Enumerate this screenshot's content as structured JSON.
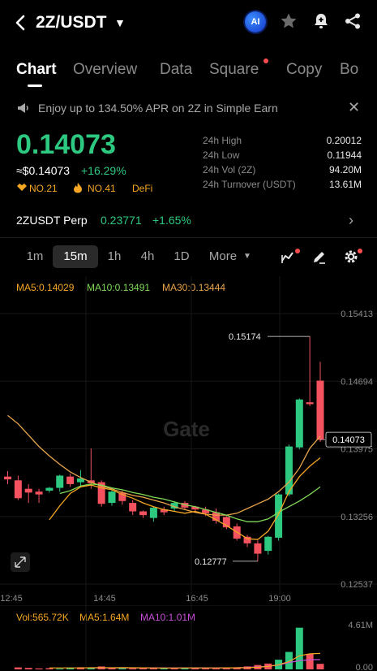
{
  "header": {
    "pair": "2Z/USDT",
    "ai_badge": "AI",
    "icons": [
      "back-icon",
      "caret-down-icon",
      "ai-icon",
      "star-icon",
      "bell-plus-icon",
      "share-icon"
    ]
  },
  "tabs": [
    {
      "label": "Chart",
      "active": true
    },
    {
      "label": "Overview",
      "active": false
    },
    {
      "label": "Data",
      "active": false
    },
    {
      "label": "Square",
      "active": false,
      "dot": true
    },
    {
      "label": "Copy",
      "active": false
    },
    {
      "label": "Bo",
      "active": false
    }
  ],
  "banner": {
    "text": "Enjoy up to 134.50% APR on 2Z in Simple Earn",
    "close": "✕"
  },
  "ticker": {
    "price": "0.14073",
    "fiat": "≈$0.14073",
    "change": "+16.29%",
    "tags": [
      "NO.21",
      "NO.41",
      "DeFi"
    ]
  },
  "stats": [
    {
      "label": "24h High",
      "value": "0.20012"
    },
    {
      "label": "24h Low",
      "value": "0.11944"
    },
    {
      "label": "24h Vol (2Z)",
      "value": "94.20M"
    },
    {
      "label": "24h Turnover (USDT)",
      "value": "13.61M"
    }
  ],
  "perp": {
    "name": "2ZUSDT Perp",
    "price": "0.23771",
    "change": "+1.65%"
  },
  "intervals": [
    {
      "label": "1m",
      "active": false
    },
    {
      "label": "15m",
      "active": true
    },
    {
      "label": "1h",
      "active": false
    },
    {
      "label": "4h",
      "active": false
    },
    {
      "label": "1D",
      "active": false
    },
    {
      "label": "More",
      "active": false
    }
  ],
  "ma": {
    "ma5": "MA5:0.14029",
    "ma10": "MA10:0.13491",
    "ma30": "MA30:0.13444"
  },
  "colors": {
    "up": "#2ec981",
    "down": "#f5525f",
    "ma5": "#f5a623",
    "ma10": "#7ed957",
    "ma30": "#e8a44a",
    "ma10_vol": "#c84ed8"
  },
  "chart_data": {
    "type": "candlestick",
    "y_ticks": [
      "0.15413",
      "0.14694",
      "0.13975",
      "0.13256",
      "0.12537"
    ],
    "ylim": [
      0.12537,
      0.15413
    ],
    "x_ticks": [
      "12:45",
      "14:45",
      "16:45",
      "19:00"
    ],
    "watermark": "Gate",
    "current_price_label": "0.14073",
    "high_label": "0.15174",
    "low_label": "0.12777",
    "candles": [
      {
        "o": 0.1368,
        "h": 0.1374,
        "c": 0.1365,
        "l": 0.136,
        "up": false
      },
      {
        "o": 0.1364,
        "h": 0.1369,
        "c": 0.1345,
        "l": 0.1343,
        "up": false
      },
      {
        "o": 0.1355,
        "h": 0.136,
        "c": 0.1351,
        "l": 0.134,
        "up": false
      },
      {
        "o": 0.1352,
        "h": 0.1355,
        "c": 0.1349,
        "l": 0.134,
        "up": false
      },
      {
        "o": 0.1353,
        "h": 0.1357,
        "c": 0.1356,
        "l": 0.1351,
        "up": true
      },
      {
        "o": 0.1356,
        "h": 0.137,
        "c": 0.1369,
        "l": 0.1352,
        "up": true
      },
      {
        "o": 0.1368,
        "h": 0.1371,
        "c": 0.136,
        "l": 0.1357,
        "up": false
      },
      {
        "o": 0.1362,
        "h": 0.1375,
        "c": 0.1366,
        "l": 0.1358,
        "up": true
      },
      {
        "o": 0.1364,
        "h": 0.1398,
        "c": 0.1361,
        "l": 0.1355,
        "up": false
      },
      {
        "o": 0.1362,
        "h": 0.1364,
        "c": 0.1339,
        "l": 0.1336,
        "up": false
      },
      {
        "o": 0.134,
        "h": 0.1354,
        "c": 0.1352,
        "l": 0.1337,
        "up": true
      },
      {
        "o": 0.1351,
        "h": 0.1353,
        "c": 0.1342,
        "l": 0.1338,
        "up": false
      },
      {
        "o": 0.134,
        "h": 0.1343,
        "c": 0.1331,
        "l": 0.1327,
        "up": false
      },
      {
        "o": 0.1331,
        "h": 0.1332,
        "c": 0.1327,
        "l": 0.1324,
        "up": false
      },
      {
        "o": 0.1324,
        "h": 0.1336,
        "c": 0.1335,
        "l": 0.132,
        "up": true
      },
      {
        "o": 0.1333,
        "h": 0.1336,
        "c": 0.133,
        "l": 0.1327,
        "up": false
      },
      {
        "o": 0.1334,
        "h": 0.1342,
        "c": 0.134,
        "l": 0.1331,
        "up": true
      },
      {
        "o": 0.134,
        "h": 0.1342,
        "c": 0.1335,
        "l": 0.1333,
        "up": false
      },
      {
        "o": 0.1336,
        "h": 0.1337,
        "c": 0.1333,
        "l": 0.1331,
        "up": false
      },
      {
        "o": 0.1333,
        "h": 0.1336,
        "c": 0.1329,
        "l": 0.1326,
        "up": false
      },
      {
        "o": 0.133,
        "h": 0.1334,
        "c": 0.1321,
        "l": 0.1318,
        "up": false
      },
      {
        "o": 0.1325,
        "h": 0.1326,
        "c": 0.1314,
        "l": 0.1312,
        "up": false
      },
      {
        "o": 0.1315,
        "h": 0.1318,
        "c": 0.1302,
        "l": 0.13,
        "up": false
      },
      {
        "o": 0.1304,
        "h": 0.1306,
        "c": 0.1297,
        "l": 0.1293,
        "up": false
      },
      {
        "o": 0.1297,
        "h": 0.13,
        "c": 0.1286,
        "l": 0.1278,
        "up": false
      },
      {
        "o": 0.1289,
        "h": 0.1305,
        "c": 0.1304,
        "l": 0.1285,
        "up": true
      },
      {
        "o": 0.1303,
        "h": 0.135,
        "c": 0.1349,
        "l": 0.13,
        "up": true
      },
      {
        "o": 0.1349,
        "h": 0.1402,
        "c": 0.14,
        "l": 0.1347,
        "up": true
      },
      {
        "o": 0.1399,
        "h": 0.1451,
        "c": 0.145,
        "l": 0.1397,
        "up": true
      },
      {
        "o": 0.1447,
        "h": 0.1517,
        "c": 0.1445,
        "l": 0.1443,
        "up": false
      },
      {
        "o": 0.147,
        "h": 0.149,
        "c": 0.1407,
        "l": 0.1405,
        "up": false
      }
    ],
    "ma5": [
      0.1322,
      0.1337,
      0.135,
      0.1357,
      0.1359,
      0.1356,
      0.1354,
      0.1349,
      0.1345,
      0.134,
      0.1336,
      0.1333,
      0.1331,
      0.1329,
      0.1331,
      0.1328,
      0.1322,
      0.1316,
      0.1309,
      0.1302,
      0.1301,
      0.131,
      0.1328,
      0.1352,
      0.1368,
      0.1379,
      0.1388
    ],
    "ma10": [
      0.135,
      0.1353,
      0.1358,
      0.136,
      0.1359,
      0.1356,
      0.1354,
      0.1351,
      0.1349,
      0.1346,
      0.1344,
      0.1341,
      0.1338,
      0.1336,
      0.1333,
      0.133,
      0.1327,
      0.1323,
      0.132,
      0.132,
      0.1323,
      0.133,
      0.1336,
      0.1342,
      0.1349,
      0.1357
    ],
    "ma30": [
      0.1433,
      0.1424,
      0.1412,
      0.14,
      0.139,
      0.1381,
      0.1373,
      0.1367,
      0.1362,
      0.1358,
      0.1355,
      0.1351,
      0.1348,
      0.1346,
      0.1343,
      0.134,
      0.1336,
      0.1333,
      0.133,
      0.1328,
      0.1327,
      0.1327,
      0.1329,
      0.1334,
      0.1339,
      0.1344,
      0.1352,
      0.1362,
      0.1377,
      0.1398,
      0.1411
    ],
    "volume": {
      "legend": [
        "Vol:565.72K",
        "MA5:1.64M",
        "MA10:1.01M"
      ],
      "y_ticks": [
        "4.61M",
        "0.00"
      ],
      "ymax": 4.61,
      "values": [
        0.2,
        0.15,
        0.1,
        0.12,
        0.08,
        0.18,
        0.22,
        0.16,
        0.3,
        0.14,
        0.12,
        0.1,
        0.15,
        0.2,
        0.12,
        0.1,
        0.14,
        0.18,
        0.12,
        0.1,
        0.16,
        0.22,
        0.3,
        0.45,
        0.6,
        1.0,
        1.8,
        4.3,
        1.6,
        0.57
      ],
      "up": [
        false,
        false,
        false,
        false,
        true,
        true,
        false,
        true,
        false,
        false,
        true,
        false,
        false,
        false,
        true,
        false,
        true,
        false,
        false,
        false,
        false,
        false,
        false,
        false,
        false,
        true,
        true,
        true,
        false,
        false
      ],
      "ma5": [
        0.15,
        0.15,
        0.15,
        0.15,
        0.17,
        0.18,
        0.17,
        0.18,
        0.17,
        0.16,
        0.15,
        0.14,
        0.14,
        0.15,
        0.15,
        0.15,
        0.15,
        0.16,
        0.16,
        0.18,
        0.22,
        0.3,
        0.48,
        0.8,
        1.4,
        1.6,
        1.64
      ],
      "ma10": [
        0.16,
        0.16,
        0.16,
        0.16,
        0.16,
        0.16,
        0.16,
        0.15,
        0.15,
        0.15,
        0.15,
        0.15,
        0.15,
        0.16,
        0.17,
        0.2,
        0.25,
        0.32,
        0.45,
        0.7,
        0.9,
        1.0,
        1.01
      ]
    }
  }
}
